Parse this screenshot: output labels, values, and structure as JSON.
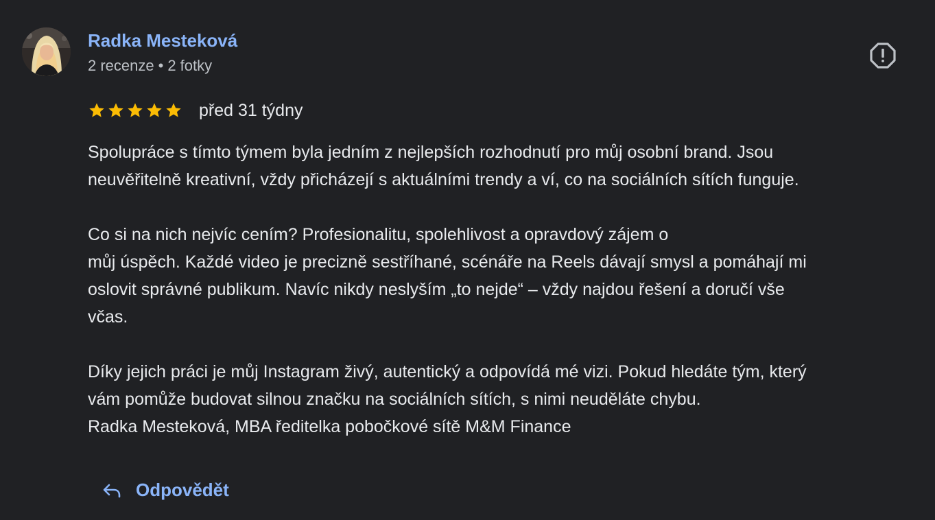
{
  "colors": {
    "background": "#202124",
    "link_blue": "#8ab4f8",
    "text_primary": "#e8eaed",
    "text_secondary": "#bdc1c6",
    "star_gold": "#fbbc04"
  },
  "author": {
    "name": "Radka Mesteková",
    "reviews_count": "2 recenze",
    "separator": "•",
    "photos_count": "2 fotky",
    "avatar_icon": "profile-photo"
  },
  "report": {
    "icon": "report-flag-icon"
  },
  "rating": {
    "stars": 5,
    "max_stars": 5,
    "time_ago": "před 31 týdny"
  },
  "review": {
    "lines": [
      "Spolupráce s tímto týmem byla jedním z nejlepších rozhodnutí pro můj osobní brand. Jsou",
      "neuvěřitelně kreativní, vždy přicházejí s aktuálními trendy a ví, co na sociálních sítích funguje.",
      "",
      "Co si na nich nejvíc cením? Profesionalitu, spolehlivost a opravdový zájem o",
      "můj úspěch. Každé video je precizně sestříhané, scénáře na Reels dávají smysl a pomáhají mi",
      "oslovit správné publikum. Navíc nikdy neslyším „to nejde“ – vždy najdou řešení a doručí vše",
      "včas.",
      "",
      "Díky jejich práci je můj Instagram živý, autentický a odpovídá mé vizi. Pokud hledáte tým, který",
      "vám pomůže budovat silnou značku na sociálních sítích, s nimi neuděláte chybu.",
      "Radka Mesteková, MBA ředitelka pobočkové sítě M&M Finance"
    ]
  },
  "actions": {
    "reply_label": "Odpovědět",
    "reply_icon": "reply-arrow-icon"
  }
}
